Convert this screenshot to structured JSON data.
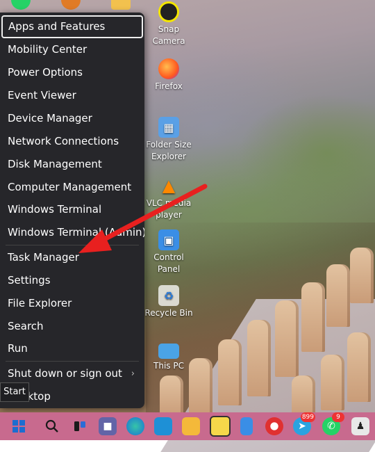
{
  "power_menu": {
    "items": [
      {
        "label": "Apps and Features",
        "focused": true
      },
      {
        "label": "Mobility Center"
      },
      {
        "label": "Power Options"
      },
      {
        "label": "Event Viewer"
      },
      {
        "label": "Device Manager"
      },
      {
        "label": "Network Connections"
      },
      {
        "label": "Disk Management"
      },
      {
        "label": "Computer Management"
      },
      {
        "label": "Windows Terminal"
      },
      {
        "label": "Windows Terminal (Admin)"
      },
      {
        "label": "Task Manager"
      },
      {
        "label": "Settings"
      },
      {
        "label": "File Explorer"
      },
      {
        "label": "Search"
      },
      {
        "label": "Run"
      },
      {
        "label": "Shut down or sign out",
        "submenu": true
      },
      {
        "label": "Desktop"
      }
    ],
    "submenu_chevron": "›"
  },
  "tooltip": "Start",
  "desktop_icons": [
    {
      "label": "Snap Camera",
      "icon": "camera-icon"
    },
    {
      "label": "Firefox",
      "icon": "firefox-icon"
    },
    {
      "label": "Folder Size Explorer",
      "icon": "folder-size-icon"
    },
    {
      "label": "VLC media player",
      "icon": "vlc-icon"
    },
    {
      "label": "Control Panel",
      "icon": "control-panel-icon"
    },
    {
      "label": "Recycle Bin",
      "icon": "recycle-bin-icon"
    },
    {
      "label": "This PC",
      "icon": "this-pc-icon"
    }
  ],
  "taskbar": {
    "badges": {
      "telegram": "899",
      "whatsapp": "9"
    }
  },
  "colors": {
    "menu_bg": "#26262a",
    "taskbar_bg": "#c86a8e",
    "arrow": "#e8201f"
  }
}
